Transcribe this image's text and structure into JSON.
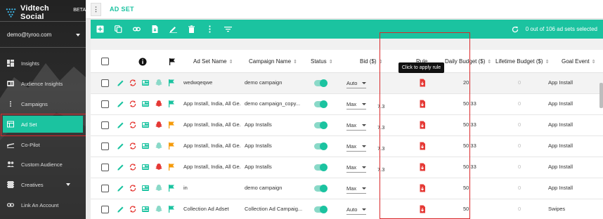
{
  "sidebar": {
    "brand_name": "Vidtech Social",
    "brand_badge": "BETA",
    "user_email": "demo@tyroo.com",
    "items": [
      {
        "label": "Insights",
        "icon": "dashboard-icon"
      },
      {
        "label": "Audience Insights",
        "icon": "id-card-icon"
      },
      {
        "label": "Campaigns",
        "icon": "list-icon"
      },
      {
        "label": "Ad Set",
        "icon": "window-icon"
      },
      {
        "label": "Co-Pilot",
        "icon": "airplane-icon"
      },
      {
        "label": "Custom Audience",
        "icon": "people-icon"
      },
      {
        "label": "Creatives",
        "icon": "film-icon"
      },
      {
        "label": "Link An Account",
        "icon": "link-icon"
      }
    ]
  },
  "topbar": {
    "menu_glyph": "⋮",
    "title": "AD SET"
  },
  "toolbar": {
    "status_text": "0 out of 106 ad sets selected"
  },
  "table": {
    "headers": {
      "ad_set_name": "Ad Set Name",
      "campaign_name": "Campaign Name",
      "status": "Status",
      "bid": "Bid ($)",
      "rule": "Rule",
      "daily_budget": "Daily Budget ($)",
      "lifetime_budget": "Lifetime Budget ($)",
      "goal_event": "Goal Event"
    },
    "rows": [
      {
        "name": "wedwqeqwe",
        "campaign": "demo campaign",
        "bid_type": "Auto",
        "bid": "",
        "daily": "20",
        "lifetime": "0",
        "goal": "App Install",
        "platform": "snapchat",
        "flag": "green"
      },
      {
        "name": "App Install, India, All Ge...",
        "campaign": "demo campaign_copy...",
        "bid_type": "Max",
        "bid": "7.3",
        "daily": "50.33",
        "lifetime": "0",
        "goal": "App Install",
        "platform": "red",
        "flag": "green"
      },
      {
        "name": "App Install, India, All Ge...",
        "campaign": "App Installs",
        "bid_type": "Max",
        "bid": "7.3",
        "daily": "50.33",
        "lifetime": "0",
        "goal": "App Install",
        "platform": "red",
        "flag": "orange"
      },
      {
        "name": "App Install, India, All Ge...",
        "campaign": "App Installs",
        "bid_type": "Max",
        "bid": "7.3",
        "daily": "50.33",
        "lifetime": "0",
        "goal": "App Install",
        "platform": "snapchat",
        "flag": "orange"
      },
      {
        "name": "App Install, India, All Ge...",
        "campaign": "App Installs",
        "bid_type": "Max",
        "bid": "7.3",
        "daily": "50.33",
        "lifetime": "0",
        "goal": "App Install",
        "platform": "red",
        "flag": "orange"
      },
      {
        "name": "in",
        "campaign": "demo campaign",
        "bid_type": "Max",
        "bid": "",
        "daily": "50",
        "lifetime": "0",
        "goal": "App Install",
        "platform": "snapchat",
        "flag": "green"
      },
      {
        "name": "Collection Ad Adset",
        "campaign": "Collection Ad Campaig...",
        "bid_type": "Auto",
        "bid": "",
        "daily": "50",
        "lifetime": "0",
        "goal": "Swipes",
        "platform": "snapchat",
        "flag": "green"
      }
    ]
  },
  "tooltip": "Click to apply rule",
  "colors": {
    "accent": "#1bc3a0",
    "red": "#e53935",
    "orange": "#f59b0a",
    "highlight": "#d9282a"
  }
}
